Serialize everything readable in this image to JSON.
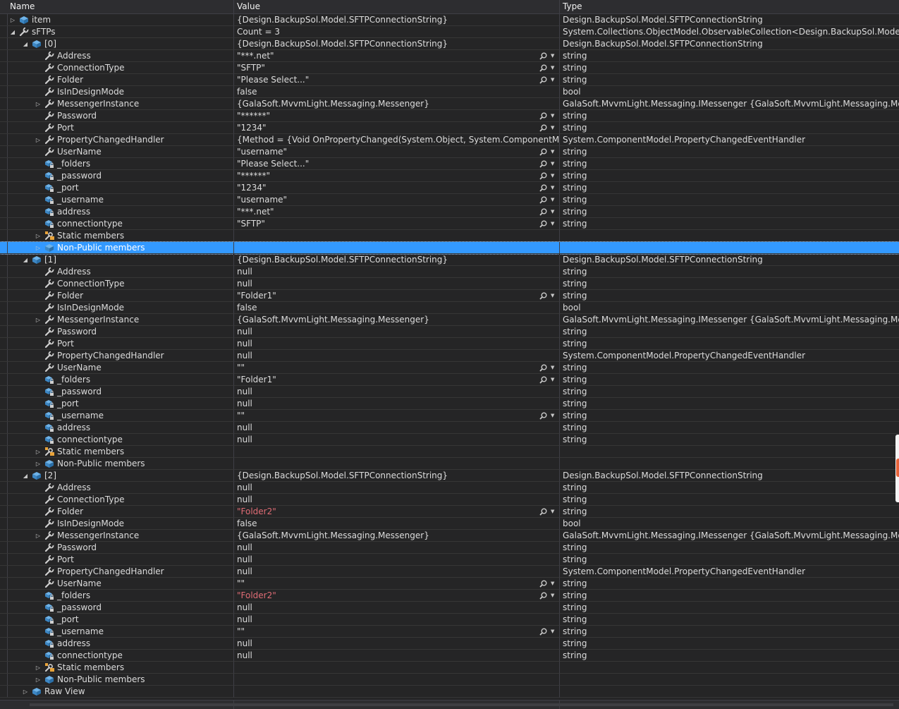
{
  "columns": {
    "name": "Name",
    "value": "Value",
    "type": "Type"
  },
  "rows": [
    {
      "d": 0,
      "exp": "c",
      "icon": "field",
      "name": "item",
      "value": "{Design.BackupSol.Model.SFTPConnectionString}",
      "type": "Design.BackupSol.Model.SFTPConnectionString"
    },
    {
      "d": 0,
      "exp": "o",
      "icon": "prop",
      "name": "sFTPs",
      "value": "Count = 3",
      "type": "System.Collections.ObjectModel.ObservableCollection<Design.BackupSol.Model.SFTPConnectionString>"
    },
    {
      "d": 1,
      "exp": "o",
      "icon": "field",
      "name": "[0]",
      "value": "{Design.BackupSol.Model.SFTPConnectionString}",
      "type": "Design.BackupSol.Model.SFTPConnectionString"
    },
    {
      "d": 2,
      "icon": "prop",
      "name": "Address",
      "value": "\"***.net\"",
      "type": "string",
      "mag": true
    },
    {
      "d": 2,
      "icon": "prop",
      "name": "ConnectionType",
      "value": "\"SFTP\"",
      "type": "string",
      "mag": true
    },
    {
      "d": 2,
      "icon": "prop",
      "name": "Folder",
      "value": "\"Please Select...\"",
      "type": "string",
      "mag": true
    },
    {
      "d": 2,
      "icon": "prop",
      "name": "IsInDesignMode",
      "value": "false",
      "type": "bool"
    },
    {
      "d": 2,
      "exp": "c",
      "icon": "prop",
      "name": "MessengerInstance",
      "value": "{GalaSoft.MvvmLight.Messaging.Messenger}",
      "type": "GalaSoft.MvvmLight.Messaging.IMessenger {GalaSoft.MvvmLight.Messaging.Messenger}"
    },
    {
      "d": 2,
      "icon": "prop",
      "name": "Password",
      "value": "\"******\"",
      "type": "string",
      "mag": true
    },
    {
      "d": 2,
      "icon": "prop",
      "name": "Port",
      "value": "\"1234\"",
      "type": "string",
      "mag": true
    },
    {
      "d": 2,
      "exp": "c",
      "icon": "prop",
      "name": "PropertyChangedHandler",
      "value": "{Method = {Void OnPropertyChanged(System.Object, System.ComponentModel.PropertyChangedEventArgs)}}",
      "type": "System.ComponentModel.PropertyChangedEventHandler"
    },
    {
      "d": 2,
      "icon": "prop",
      "name": "UserName",
      "value": "\"username\"",
      "type": "string",
      "mag": true
    },
    {
      "d": 2,
      "icon": "pfield",
      "name": "_folders",
      "value": "\"Please Select...\"",
      "type": "string",
      "mag": true
    },
    {
      "d": 2,
      "icon": "pfield",
      "name": "_password",
      "value": "\"******\"",
      "type": "string",
      "mag": true
    },
    {
      "d": 2,
      "icon": "pfield",
      "name": "_port",
      "value": "\"1234\"",
      "type": "string",
      "mag": true
    },
    {
      "d": 2,
      "icon": "pfield",
      "name": "_username",
      "value": "\"username\"",
      "type": "string",
      "mag": true
    },
    {
      "d": 2,
      "icon": "pfield",
      "name": "address",
      "value": "\"***.net\"",
      "type": "string",
      "mag": true
    },
    {
      "d": 2,
      "icon": "pfield",
      "name": "connectiontype",
      "value": "\"SFTP\"",
      "type": "string",
      "mag": true
    },
    {
      "d": 2,
      "exp": "c",
      "icon": "static",
      "name": "Static members",
      "value": "",
      "type": ""
    },
    {
      "d": 2,
      "exp": "c",
      "icon": "field",
      "name": "Non-Public members",
      "value": "",
      "type": "",
      "selected": true
    },
    {
      "d": 1,
      "exp": "o",
      "icon": "field",
      "name": "[1]",
      "value": "{Design.BackupSol.Model.SFTPConnectionString}",
      "type": "Design.BackupSol.Model.SFTPConnectionString"
    },
    {
      "d": 2,
      "icon": "prop",
      "name": "Address",
      "value": "null",
      "type": "string"
    },
    {
      "d": 2,
      "icon": "prop",
      "name": "ConnectionType",
      "value": "null",
      "type": "string"
    },
    {
      "d": 2,
      "icon": "prop",
      "name": "Folder",
      "value": "\"Folder1\"",
      "type": "string",
      "mag": true
    },
    {
      "d": 2,
      "icon": "prop",
      "name": "IsInDesignMode",
      "value": "false",
      "type": "bool"
    },
    {
      "d": 2,
      "exp": "c",
      "icon": "prop",
      "name": "MessengerInstance",
      "value": "{GalaSoft.MvvmLight.Messaging.Messenger}",
      "type": "GalaSoft.MvvmLight.Messaging.IMessenger {GalaSoft.MvvmLight.Messaging.Messenger}"
    },
    {
      "d": 2,
      "icon": "prop",
      "name": "Password",
      "value": "null",
      "type": "string"
    },
    {
      "d": 2,
      "icon": "prop",
      "name": "Port",
      "value": "null",
      "type": "string"
    },
    {
      "d": 2,
      "icon": "prop",
      "name": "PropertyChangedHandler",
      "value": "null",
      "type": "System.ComponentModel.PropertyChangedEventHandler"
    },
    {
      "d": 2,
      "icon": "prop",
      "name": "UserName",
      "value": "\"\"",
      "type": "string",
      "mag": true
    },
    {
      "d": 2,
      "icon": "pfield",
      "name": "_folders",
      "value": "\"Folder1\"",
      "type": "string",
      "mag": true
    },
    {
      "d": 2,
      "icon": "pfield",
      "name": "_password",
      "value": "null",
      "type": "string"
    },
    {
      "d": 2,
      "icon": "pfield",
      "name": "_port",
      "value": "null",
      "type": "string"
    },
    {
      "d": 2,
      "icon": "pfield",
      "name": "_username",
      "value": "\"\"",
      "type": "string",
      "mag": true
    },
    {
      "d": 2,
      "icon": "pfield",
      "name": "address",
      "value": "null",
      "type": "string"
    },
    {
      "d": 2,
      "icon": "pfield",
      "name": "connectiontype",
      "value": "null",
      "type": "string"
    },
    {
      "d": 2,
      "exp": "c",
      "icon": "static",
      "name": "Static members",
      "value": "",
      "type": ""
    },
    {
      "d": 2,
      "exp": "c",
      "icon": "field",
      "name": "Non-Public members",
      "value": "",
      "type": ""
    },
    {
      "d": 1,
      "exp": "o",
      "icon": "field",
      "name": "[2]",
      "value": "{Design.BackupSol.Model.SFTPConnectionString}",
      "type": "Design.BackupSol.Model.SFTPConnectionString"
    },
    {
      "d": 2,
      "icon": "prop",
      "name": "Address",
      "value": "null",
      "type": "string"
    },
    {
      "d": 2,
      "icon": "prop",
      "name": "ConnectionType",
      "value": "null",
      "type": "string"
    },
    {
      "d": 2,
      "icon": "prop",
      "name": "Folder",
      "value": "\"Folder2\"",
      "type": "string",
      "mag": true,
      "changed": true
    },
    {
      "d": 2,
      "icon": "prop",
      "name": "IsInDesignMode",
      "value": "false",
      "type": "bool"
    },
    {
      "d": 2,
      "exp": "c",
      "icon": "prop",
      "name": "MessengerInstance",
      "value": "{GalaSoft.MvvmLight.Messaging.Messenger}",
      "type": "GalaSoft.MvvmLight.Messaging.IMessenger {GalaSoft.MvvmLight.Messaging.Messenger}"
    },
    {
      "d": 2,
      "icon": "prop",
      "name": "Password",
      "value": "null",
      "type": "string"
    },
    {
      "d": 2,
      "icon": "prop",
      "name": "Port",
      "value": "null",
      "type": "string"
    },
    {
      "d": 2,
      "icon": "prop",
      "name": "PropertyChangedHandler",
      "value": "null",
      "type": "System.ComponentModel.PropertyChangedEventHandler"
    },
    {
      "d": 2,
      "icon": "prop",
      "name": "UserName",
      "value": "\"\"",
      "type": "string",
      "mag": true
    },
    {
      "d": 2,
      "icon": "pfield",
      "name": "_folders",
      "value": "\"Folder2\"",
      "type": "string",
      "mag": true,
      "changed": true
    },
    {
      "d": 2,
      "icon": "pfield",
      "name": "_password",
      "value": "null",
      "type": "string"
    },
    {
      "d": 2,
      "icon": "pfield",
      "name": "_port",
      "value": "null",
      "type": "string"
    },
    {
      "d": 2,
      "icon": "pfield",
      "name": "_username",
      "value": "\"\"",
      "type": "string",
      "mag": true
    },
    {
      "d": 2,
      "icon": "pfield",
      "name": "address",
      "value": "null",
      "type": "string"
    },
    {
      "d": 2,
      "icon": "pfield",
      "name": "connectiontype",
      "value": "null",
      "type": "string"
    },
    {
      "d": 2,
      "exp": "c",
      "icon": "static",
      "name": "Static members",
      "value": "",
      "type": ""
    },
    {
      "d": 2,
      "exp": "c",
      "icon": "field",
      "name": "Non-Public members",
      "value": "",
      "type": ""
    },
    {
      "d": 1,
      "exp": "c",
      "icon": "field",
      "name": "Raw View",
      "value": "",
      "type": ""
    }
  ],
  "colors": {
    "background": "#252526",
    "selection": "#3399ff",
    "changed_value": "#e06c75",
    "icon_blue": "#6fb3e8",
    "icon_orange": "#e8a33a"
  }
}
